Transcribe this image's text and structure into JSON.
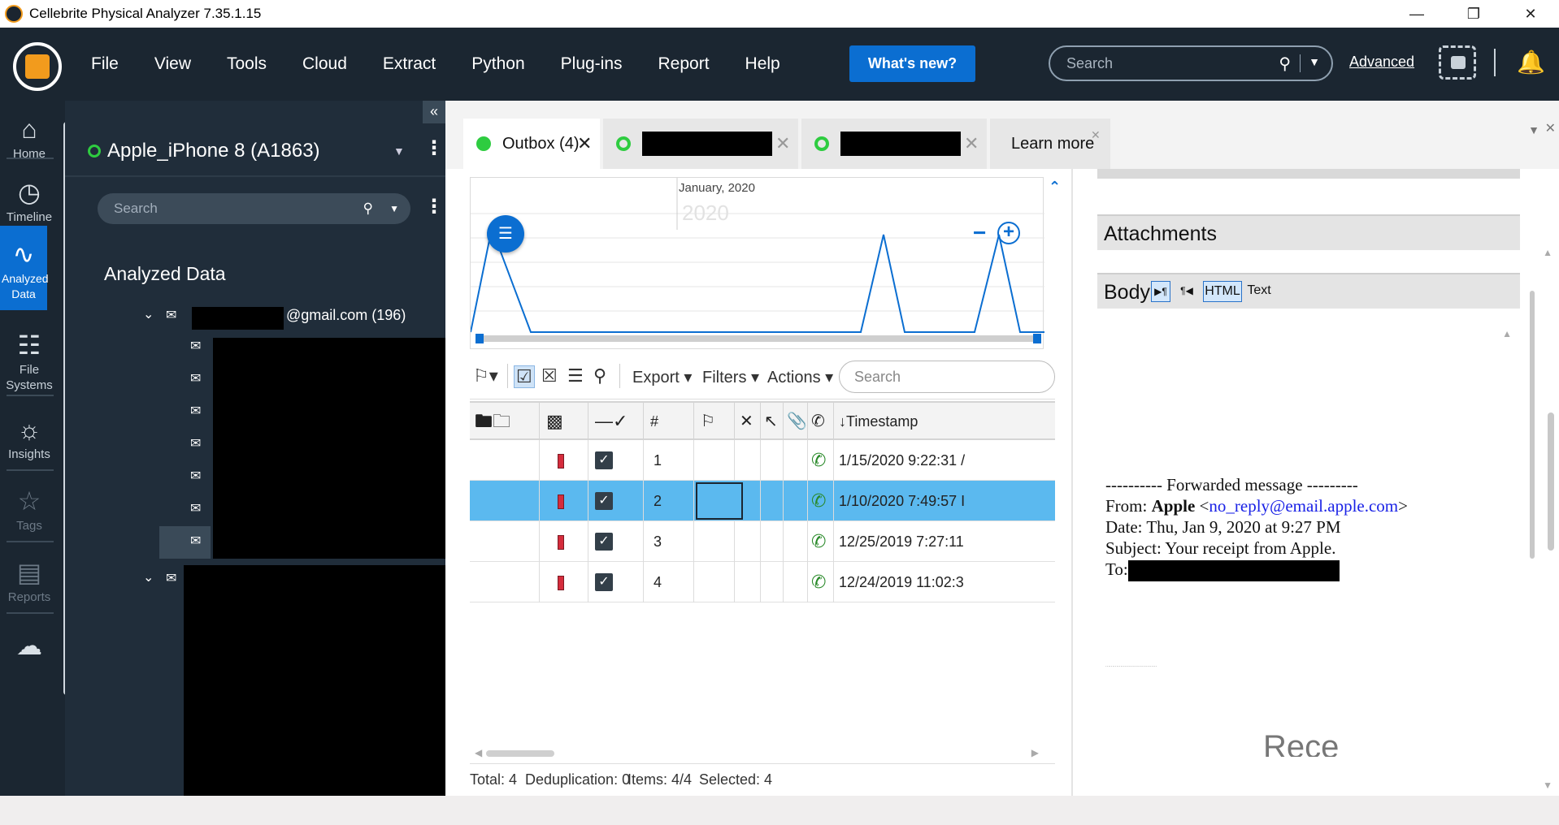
{
  "window": {
    "title": "Cellebrite Physical Analyzer 7.35.1.15",
    "controls": [
      "—",
      "❐",
      "✕"
    ]
  },
  "menubar": {
    "items": [
      "File",
      "View",
      "Tools",
      "Cloud",
      "Extract",
      "Python",
      "Plug-ins",
      "Report",
      "Help"
    ],
    "whats_new": "What's new?",
    "search_placeholder": "Search",
    "advanced": "Advanced"
  },
  "rail": {
    "items": [
      {
        "label": "Home",
        "icon": "home-icon"
      },
      {
        "label": "Timeline",
        "icon": "clock-icon"
      },
      {
        "label": "Analyzed Data",
        "icon": "pulse-icon",
        "active": true
      },
      {
        "label": "File Systems",
        "icon": "folder-tree-icon"
      },
      {
        "label": "Insights",
        "icon": "lightbulb-icon"
      },
      {
        "label": "Tags",
        "icon": "tag-icon"
      },
      {
        "label": "Reports",
        "icon": "report-icon"
      },
      {
        "label": "",
        "icon": "cloud-icon"
      }
    ]
  },
  "device_panel": {
    "device_name": "Apple_iPhone 8 (A1863)",
    "search_placeholder": "Search",
    "section_title": "Analyzed Data",
    "account": {
      "suffix": "@gmail.com (196)"
    }
  },
  "tabs": [
    {
      "label": "Outbox (4)",
      "active": true
    },
    {
      "label": "",
      "redacted": true
    },
    {
      "label": "",
      "redacted": true
    },
    {
      "label": "Learn more"
    }
  ],
  "timeline": {
    "month_label": "January, 2020",
    "year_label": "2020"
  },
  "toolbar": {
    "export": "Export",
    "filters": "Filters",
    "actions": "Actions",
    "search_placeholder": "Search"
  },
  "table": {
    "columns": {
      "number": "#",
      "timestamp": "Timestamp"
    },
    "rows": [
      {
        "n": "1",
        "timestamp": "1/15/2020 9:22:31 /"
      },
      {
        "n": "2",
        "timestamp": "1/10/2020 7:49:57 I",
        "selected": true
      },
      {
        "n": "3",
        "timestamp": "12/25/2019 7:27:11"
      },
      {
        "n": "4",
        "timestamp": "12/24/2019 11:02:3"
      }
    ]
  },
  "status": {
    "total": "Total: 4",
    "dedup": "Deduplication: 0",
    "items": "Items: 4/4",
    "selected": "Selected: 4"
  },
  "details": {
    "attachments_title": "Attachments",
    "body_title": "Body",
    "format_html": "HTML",
    "format_text": "Text",
    "email": {
      "forwarded": "---------- Forwarded message ---------",
      "from_label": "From:",
      "from_name": "Apple",
      "from_email": "no_reply@email.apple.com",
      "date_line": "Date: Thu, Jan 9, 2020 at 9:27 PM",
      "subject_line": "Subject: Your receipt from Apple.",
      "to_label": "To:"
    },
    "bottom_text": "Rece"
  },
  "colors": {
    "accent": "#0b6ed1",
    "dark_bg": "#1b2631",
    "panel_bg": "#202d3a",
    "row_selected": "#5bb9ef",
    "status_green": "#2ecc40"
  }
}
